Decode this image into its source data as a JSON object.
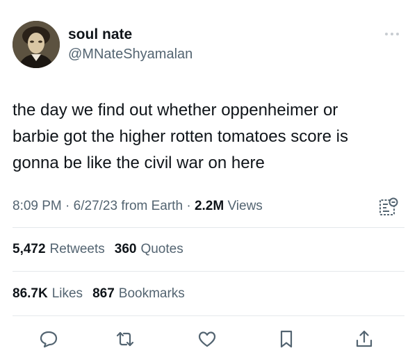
{
  "author": {
    "display_name": "soul nate",
    "handle": "@MNateShyamalan"
  },
  "tweet": {
    "lines": [
      "the day we find out whether oppenheimer or",
      "barbie got the higher rotten tomatoes score is",
      "gonna be like the civil war on here"
    ]
  },
  "meta": {
    "time": "8:09 PM",
    "sep1": " · ",
    "date": "6/27/23",
    "source": " from Earth",
    "sep2": " · ",
    "views_count": "2.2M",
    "views_label": "Views"
  },
  "stats": {
    "retweets_count": "5,472",
    "retweets_label": "Retweets",
    "quotes_count": "360",
    "quotes_label": "Quotes",
    "likes_count": "86.7K",
    "likes_label": "Likes",
    "bookmarks_count": "867",
    "bookmarks_label": "Bookmarks"
  },
  "colors": {
    "text": "#0f1419",
    "secondary": "#536471",
    "divider": "#e4e8eb"
  },
  "icons": [
    "more-icon",
    "analytics-icon",
    "reply-icon",
    "retweet-icon",
    "like-icon",
    "bookmark-icon",
    "share-icon"
  ]
}
